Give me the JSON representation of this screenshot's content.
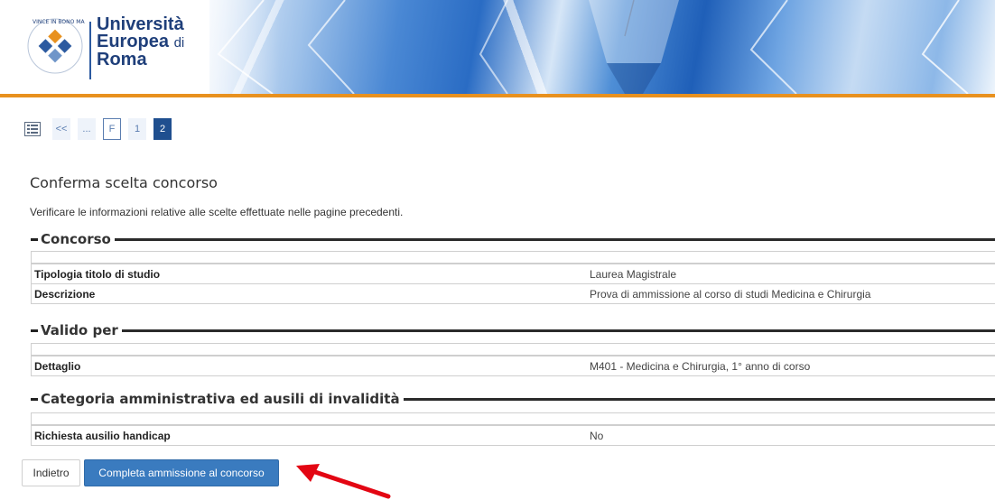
{
  "header": {
    "logo_line1": "Università",
    "logo_line2": "Europea",
    "logo_line2_small": "di",
    "logo_line3": "Roma",
    "accent_color": "#e8911f",
    "brand_color": "#1f3f7a"
  },
  "steps": {
    "icon": "list-icon",
    "items": [
      "<<",
      "...",
      "F",
      "1",
      "2"
    ],
    "active": "2"
  },
  "page": {
    "title": "Conferma scelta concorso",
    "intro": "Verificare le informazioni relative alle scelte effettuate nelle pagine precedenti."
  },
  "sections": [
    {
      "title": "Concorso",
      "rows": [
        {
          "label": "Tipologia titolo di studio",
          "value": "Laurea Magistrale"
        },
        {
          "label": "Descrizione",
          "value": "Prova di ammissione al corso di studi Medicina e Chirurgia"
        }
      ]
    },
    {
      "title": "Valido per",
      "rows": [
        {
          "label": "Dettaglio",
          "value": "M401 - Medicina e Chirurgia, 1° anno di corso"
        }
      ]
    },
    {
      "title": "Categoria amministrativa ed ausili di invalidità",
      "rows": [
        {
          "label": "Richiesta ausilio handicap",
          "value": "No"
        }
      ]
    }
  ],
  "buttons": {
    "back": "Indietro",
    "complete": "Completa ammissione al concorso"
  },
  "annotation": {
    "arrow_color": "#e30613"
  }
}
